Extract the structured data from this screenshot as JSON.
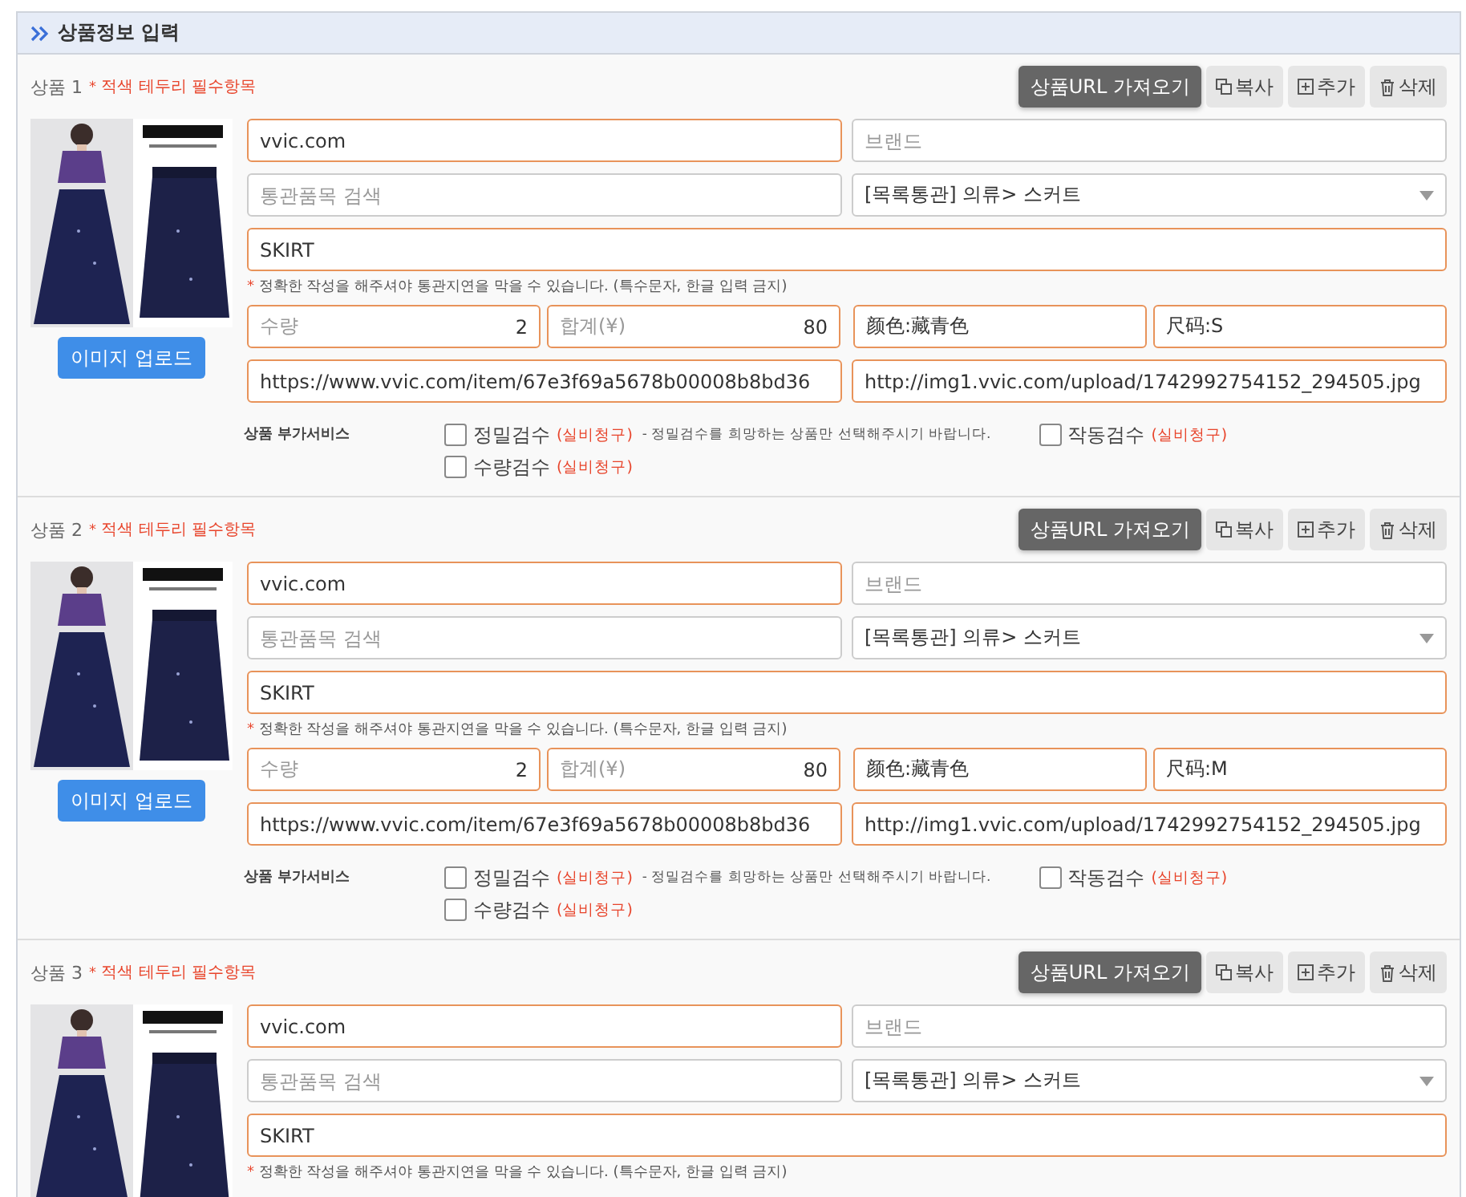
{
  "section": {
    "title": "상품정보 입력"
  },
  "products": [
    {
      "label": "상품 1",
      "required_marker": "*",
      "required_note": "적색 테두리 필수항목",
      "actions": [
        {
          "kind": "primary",
          "label": "상품URL 가져오기"
        },
        {
          "kind": "copy",
          "label": "복사"
        },
        {
          "kind": "add",
          "label": "추가"
        },
        {
          "kind": "delete",
          "label": "삭제"
        }
      ],
      "upload_button": "이미지 업로드",
      "site": {
        "value": "vvic.com",
        "required": true
      },
      "brand": {
        "placeholder": "브랜드",
        "required": false
      },
      "customs_search": {
        "placeholder": "통관품목 검색",
        "required": false
      },
      "category": {
        "value": "[목록통관] 의류> 스커트"
      },
      "name": {
        "value": "SKIRT",
        "required": true
      },
      "name_note": "정확한 작성을 해주셔야 통관지연을 막을 수 있습니다. (특수문자, 한글 입력 금지)",
      "quantity": {
        "label": "수량",
        "value": "2",
        "required": true
      },
      "total": {
        "label": "합계(¥)",
        "value": "80",
        "required": true
      },
      "option_1": {
        "value": "颜色:藏青色",
        "required": true
      },
      "option_2": {
        "value": "尺码:S",
        "required": true
      },
      "product_url": {
        "value": "https://www.vvic.com/item/67e3f69a5678b00008b8bd36",
        "required": true
      },
      "image_url": {
        "value": "http://img1.vvic.com/upload/1742992754152_294505.jpg",
        "required": true
      },
      "services": {
        "label": "상품 부가서비스",
        "note": "- 정밀검수를 희망하는 상품만 선택해주시기 바랍니다.",
        "items": [
          {
            "label": "정밀검수",
            "fee": "(실비청구)",
            "checked": false
          },
          {
            "label": "작동검수",
            "fee": "(실비청구)",
            "checked": false
          },
          {
            "label": "수량검수",
            "fee": "(실비청구)",
            "checked": false
          }
        ]
      }
    },
    {
      "label": "상품 2",
      "required_marker": "*",
      "required_note": "적색 테두리 필수항목",
      "actions": [
        {
          "kind": "primary",
          "label": "상품URL 가져오기"
        },
        {
          "kind": "copy",
          "label": "복사"
        },
        {
          "kind": "add",
          "label": "추가"
        },
        {
          "kind": "delete",
          "label": "삭제"
        }
      ],
      "upload_button": "이미지 업로드",
      "site": {
        "value": "vvic.com",
        "required": true
      },
      "brand": {
        "placeholder": "브랜드",
        "required": false
      },
      "customs_search": {
        "placeholder": "통관품목 검색",
        "required": false
      },
      "category": {
        "value": "[목록통관] 의류> 스커트"
      },
      "name": {
        "value": "SKIRT",
        "required": true
      },
      "name_note": "정확한 작성을 해주셔야 통관지연을 막을 수 있습니다. (특수문자, 한글 입력 금지)",
      "quantity": {
        "label": "수량",
        "value": "2",
        "required": true
      },
      "total": {
        "label": "합계(¥)",
        "value": "80",
        "required": true
      },
      "option_1": {
        "value": "颜色:藏青色",
        "required": true
      },
      "option_2": {
        "value": "尺码:M",
        "required": true
      },
      "product_url": {
        "value": "https://www.vvic.com/item/67e3f69a5678b00008b8bd36",
        "required": true
      },
      "image_url": {
        "value": "http://img1.vvic.com/upload/1742992754152_294505.jpg",
        "required": true
      },
      "services": {
        "label": "상품 부가서비스",
        "note": "- 정밀검수를 희망하는 상품만 선택해주시기 바랍니다.",
        "items": [
          {
            "label": "정밀검수",
            "fee": "(실비청구)",
            "checked": false
          },
          {
            "label": "작동검수",
            "fee": "(실비청구)",
            "checked": false
          },
          {
            "label": "수량검수",
            "fee": "(실비청구)",
            "checked": false
          }
        ]
      }
    },
    {
      "label": "상품 3",
      "required_marker": "*",
      "required_note": "적색 테두리 필수항목",
      "actions": [
        {
          "kind": "primary",
          "label": "상품URL 가져오기"
        },
        {
          "kind": "copy",
          "label": "복사"
        },
        {
          "kind": "add",
          "label": "추가"
        },
        {
          "kind": "delete",
          "label": "삭제"
        }
      ],
      "site": {
        "value": "vvic.com",
        "required": true
      },
      "brand": {
        "placeholder": "브랜드",
        "required": false
      },
      "customs_search": {
        "placeholder": "통관품목 검색",
        "required": false
      },
      "category": {
        "value": "[목록통관] 의류> 스커트"
      },
      "name": {
        "value": "SKIRT",
        "required": true
      },
      "name_note": "정확한 작성을 해주셔야 통관지연을 막을 수 있습니다. (특수문자, 한글 입력 금지)"
    }
  ]
}
